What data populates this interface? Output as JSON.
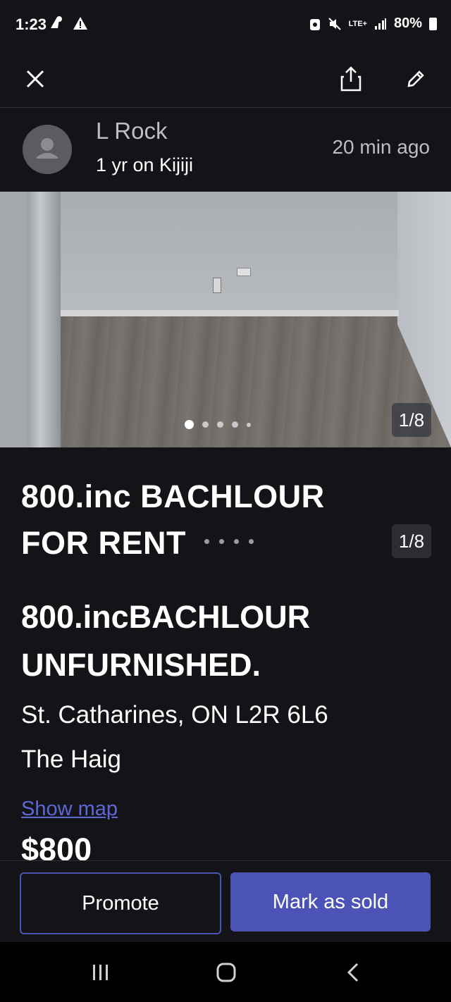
{
  "status_bar": {
    "time": "1:23",
    "network": "LTE+",
    "battery": "80%"
  },
  "toolbar": {
    "close_icon": "close-icon",
    "share_icon": "share-icon",
    "edit_icon": "edit-icon"
  },
  "seller": {
    "name": "L Rock",
    "tenure": "1 yr on Kijiji",
    "posted": "20 min  ago"
  },
  "gallery": {
    "counter": "1/8",
    "current_index": 1,
    "total": 8
  },
  "listing": {
    "title_line1": "800.inc BACHLOUR",
    "title_line2": "FOR RENT",
    "counter_overlay": "1/8",
    "subtitle_line1": "800.incBACHLOUR",
    "subtitle_line2": "UNFURNISHED.",
    "address": "St. Catharines, ON L2R 6L6",
    "neighborhood": "The Haig",
    "show_map": "Show map",
    "price": "$800"
  },
  "actions": {
    "promote": "Promote",
    "mark_sold": "Mark as sold"
  },
  "colors": {
    "background": "#141418",
    "accent": "#4b53b6",
    "link": "#5d67d6"
  }
}
